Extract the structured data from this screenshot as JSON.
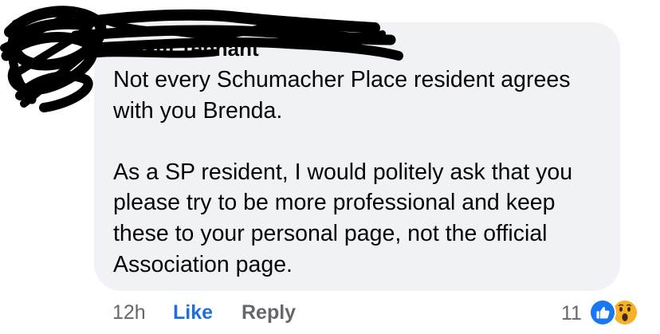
{
  "comment": {
    "author": "Adam Tennant",
    "paragraphs": [
      "Not every Schumacher Place resident agrees with you Brenda.",
      "As a SP resident, I would politely ask that you please try to be more professional and keep these to your personal page, not the official Association page."
    ]
  },
  "actions": {
    "timestamp": "12h",
    "like_label": "Like",
    "reply_label": "Reply"
  },
  "reactions": {
    "count": "11",
    "types": [
      "like-icon",
      "wow-icon"
    ]
  },
  "colors": {
    "bubble": "#f0f2f5",
    "text": "#050505",
    "secondary": "#65676b",
    "like_blue": "#216fdb",
    "wow_yellow": "#f7b125"
  }
}
